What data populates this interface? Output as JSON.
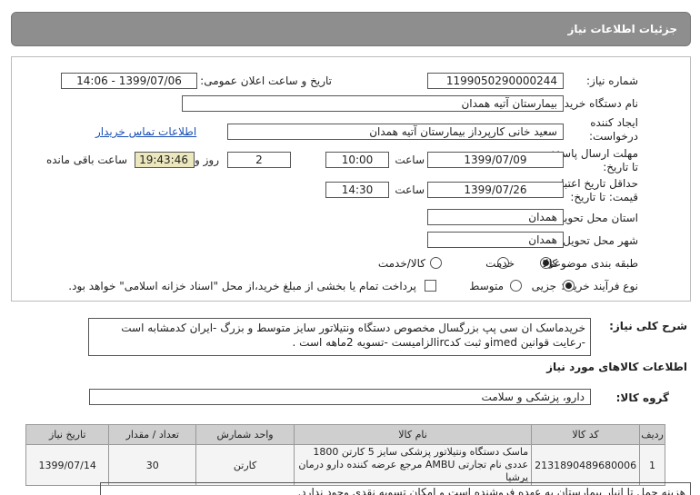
{
  "header": {
    "title": "جزئیات اطلاعات نیاز"
  },
  "form": {
    "need_number_label": "شماره نیاز:",
    "need_number": "1199050290000244",
    "announce_label": "تاریخ و ساعت اعلان عمومی:",
    "announce_value": "1399/07/06 - 14:06",
    "buyer_org_label": "نام دستگاه خریدار:",
    "buyer_org": "بیمارستان آتیه همدان",
    "creator_label_1": "ایجاد کننده",
    "creator_label_2": "درخواست:",
    "creator": "سعید خانی کارپرداز بیمارستان آتیه همدان",
    "contact_link": "اطلاعات تماس خریدار",
    "reply_deadline_label_1": "مهلت ارسال پاسخ:",
    "reply_deadline_label_2": "تا تاریخ:",
    "reply_date": "1399/07/09",
    "time_label": "ساعت",
    "reply_time": "10:00",
    "days_value": "2",
    "days_label": "روز و",
    "remaining_time": "19:43:46",
    "remaining_label": "ساعت باقی مانده",
    "validity_label_1": "حداقل تاریخ اعتبار",
    "validity_label_2": "قیمت: تا تاریخ:",
    "validity_date": "1399/07/26",
    "validity_time_label": "ساعت",
    "validity_time": "14:30",
    "province_label": "استان محل تحویل:",
    "province": "همدان",
    "city_label": "شهر محل تحویل:",
    "city": "همدان",
    "category_label": "طبقه بندی موضوعی:",
    "category_options": [
      "کالا",
      "خدمت",
      "کالا/خدمت"
    ],
    "category_selected": 0,
    "process_label": "نوع فرآیند خرید :",
    "process_options": [
      "جزیی",
      "متوسط"
    ],
    "process_selected": 0,
    "payment_note": "پرداخت تمام یا بخشی از مبلغ خرید،از محل \"اسناد خزانه اسلامی\" خواهد بود."
  },
  "description": {
    "label": "شرح کلی نیاز:",
    "text": "خریدماسک ان سی پپ بزرگسال مخصوص دستگاه ونتیلاتور سایز متوسط و بزرگ -ایران کدمشابه است -رعایت قوانین imedو ثبت کدircالزامیست -تسویه 2ماهه است ."
  },
  "goods_section": {
    "title": "اطلاعات کالاهای مورد نیاز",
    "group_label": "گروه کالا:",
    "group_value": "دارو، پزشکی و سلامت",
    "columns": [
      "ردیف",
      "کد کالا",
      "نام کالا",
      "واحد شمارش",
      "تعداد / مقدار",
      "تاریخ نیاز"
    ],
    "rows": [
      {
        "index": "1",
        "code": "2131890489680006",
        "name": "ماسک دستگاه ونتیلاتور پزشکی سایز 5 کارتن 1800 عددی نام تجارتی AMBU مرجع عرضه کننده دارو درمان پرشیا",
        "unit": "کارتن",
        "qty": "30",
        "date": "1399/07/14"
      }
    ]
  },
  "bottom_note": "هزینه حمل تا انبار بیمارستان به عهده فروشنده است و امکان تسویه نقدی وجود ندارد."
}
